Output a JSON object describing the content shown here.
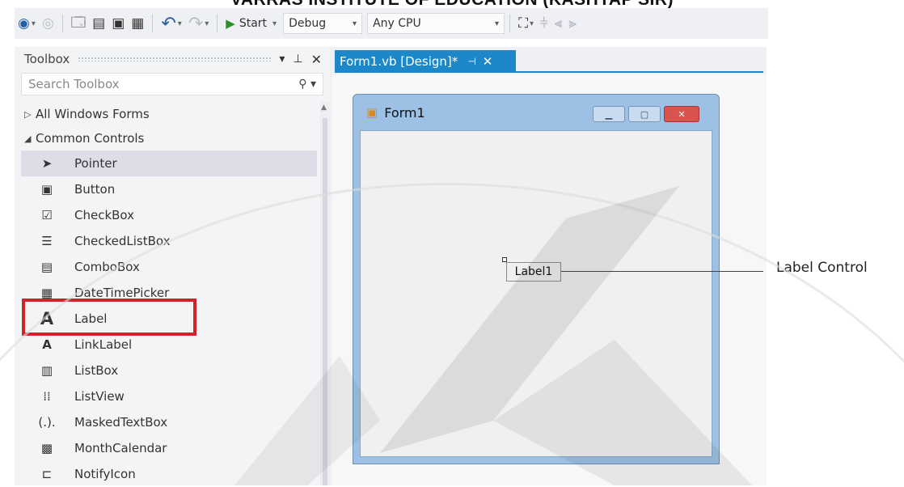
{
  "header": {
    "title": "VARRAS INSTITUTE OF EDUCATION (KASHYAP SIR)"
  },
  "toolbar": {
    "start_label": "Start",
    "config_label": "Debug",
    "platform_label": "Any CPU"
  },
  "toolbox": {
    "title": "Toolbox",
    "search_placeholder": "Search Toolbox",
    "categories": [
      "All Windows Forms",
      "Common Controls"
    ],
    "items": [
      {
        "label": "Pointer",
        "icon": "pointer-icon"
      },
      {
        "label": "Button",
        "icon": "button-icon"
      },
      {
        "label": "CheckBox",
        "icon": "checkbox-icon"
      },
      {
        "label": "CheckedListBox",
        "icon": "checked-list-icon"
      },
      {
        "label": "ComboBox",
        "icon": "combobox-icon"
      },
      {
        "label": "DateTimePicker",
        "icon": "datetime-icon"
      },
      {
        "label": "Label",
        "icon": "label-a-icon"
      },
      {
        "label": "LinkLabel",
        "icon": "linklabel-icon"
      },
      {
        "label": "ListBox",
        "icon": "listbox-icon"
      },
      {
        "label": "ListView",
        "icon": "listview-icon"
      },
      {
        "label": "MaskedTextBox",
        "icon": "masked-textbox-icon"
      },
      {
        "label": "MonthCalendar",
        "icon": "calendar-icon"
      },
      {
        "label": "NotifyIcon",
        "icon": "notify-icon"
      }
    ]
  },
  "document": {
    "tab_label": "Form1.vb [Design]*"
  },
  "form": {
    "title": "Form1",
    "label_text": "Label1"
  },
  "annotation": {
    "text": "Label Control"
  },
  "colors": {
    "accent": "#1d88c9",
    "highlight": "#d2232a"
  }
}
